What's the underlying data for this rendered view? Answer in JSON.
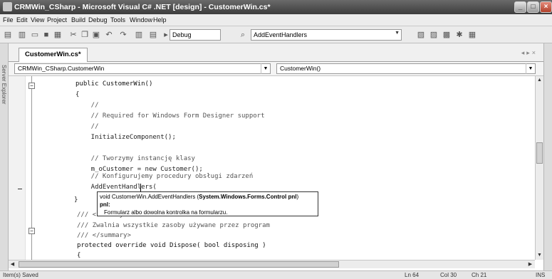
{
  "window": {
    "title": "CRMWin_CSharp - Microsoft Visual C# .NET [design] - CustomerWin.cs*"
  },
  "menu": [
    "File",
    "Edit",
    "View",
    "Project",
    "Build",
    "Debug",
    "Tools",
    "Window",
    "Help"
  ],
  "toolbar": {
    "config": "Debug",
    "method": "AddEventHandlers"
  },
  "document": {
    "tab": "CustomerWin.cs*",
    "class_combo": "CRMWin_CSharp.CustomerWin",
    "member_combo": "CustomerWin()"
  },
  "side": {
    "left_label": "Server Explorer"
  },
  "code": [
    "public CustomerWin()",
    "{",
    "    //",
    "    // Required for Windows Form Designer support",
    "    //",
    "    InitializeComponent();",
    "",
    "    // Tworzymy instancję klasy",
    "    m_oCustomer = new Customer();",
    "",
    "    // Konfigurujemy procedury obsługi zdarzeń",
    "    AddEventHandlers(",
    "}",
    "/// <summary>",
    "/// Zwalnia wszystkie zasoby używane przez program",
    "/// </summary>",
    "protected override void Dispose( bool disposing )",
    "{"
  ],
  "tooltip": {
    "sig_prefix": "void CustomerWin.AddEventHandlers (",
    "sig_param": "System.Windows.Forms.Control pnl",
    "sig_suffix": ")",
    "param_name": "pnl:",
    "param_desc": "Formularz albo dowolna kontrolka na formularzu."
  },
  "status": {
    "message": "Item(s) Saved",
    "ln": "Ln 64",
    "col": "Col 30",
    "ch": "Ch 21",
    "mode": "INS"
  }
}
